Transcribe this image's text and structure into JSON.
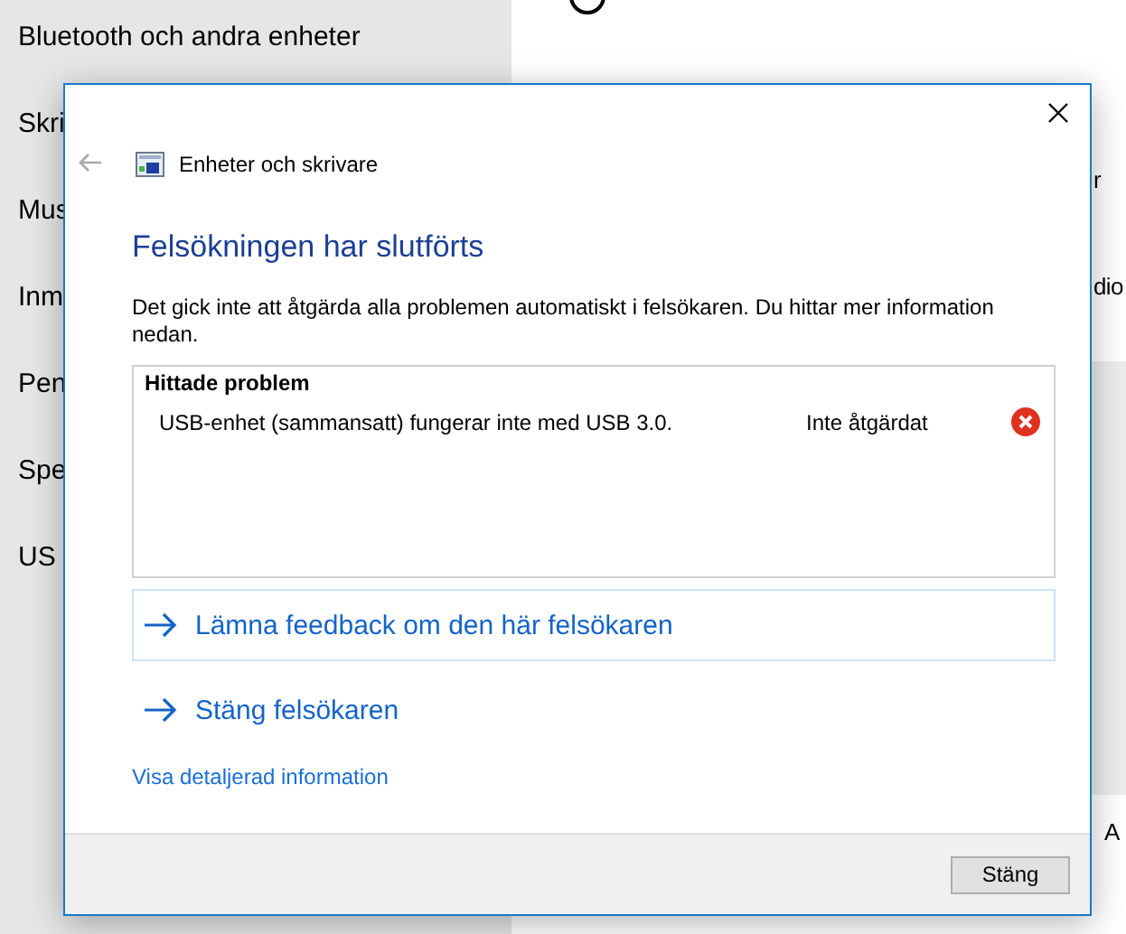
{
  "background": {
    "sidebar_items": [
      "Bluetooth och andra enheter",
      "Skri",
      "Mus",
      "Inm",
      "Pen",
      "Spe",
      "US"
    ],
    "right_fragments": [
      {
        "text": "r",
        "kind": "text"
      },
      {
        "text": "dio",
        "kind": "text"
      },
      {
        "text": "A",
        "kind": "text"
      }
    ]
  },
  "dialog": {
    "location": "Enheter och skrivare",
    "heading": "Felsökningen har slutförts",
    "message": "Det gick inte att åtgärda alla problemen automatiskt i felsökaren. Du hittar mer information nedan.",
    "problems": {
      "title": "Hittade problem",
      "items": [
        {
          "name": "USB-enhet (sammansatt) fungerar inte med USB 3.0.",
          "status": "Inte åtgärdat",
          "kind": "error"
        }
      ]
    },
    "actions": [
      {
        "label": "Lämna feedback om den här felsökaren",
        "highlighted": true
      },
      {
        "label": "Stäng felsökaren",
        "highlighted": false
      }
    ],
    "details_link": "Visa detaljerad information",
    "buttons": [
      "Stäng"
    ]
  }
}
